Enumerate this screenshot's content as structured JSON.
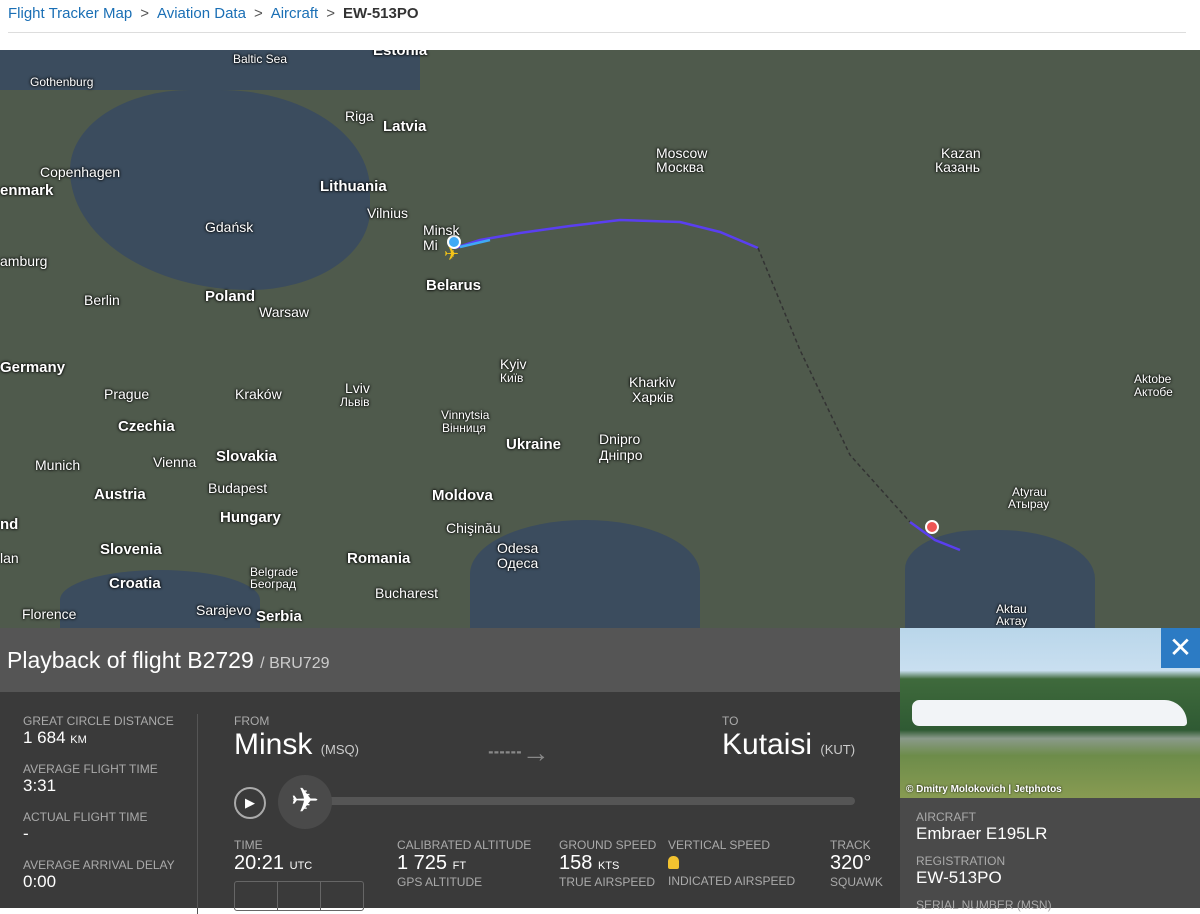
{
  "breadcrumb": [
    "Flight Tracker Map",
    "Aviation Data",
    "Aircraft",
    "EW-513PO"
  ],
  "map": {
    "labels": [
      [
        "Gothenburg",
        "sm",
        30,
        75
      ],
      [
        "Baltic Sea",
        "sm",
        233,
        52
      ],
      [
        "Riga",
        "",
        345,
        108
      ],
      [
        "Latvia",
        "big",
        383,
        118
      ],
      [
        "Estonia",
        "big",
        373,
        42
      ],
      [
        "Copenhagen",
        "",
        40,
        164
      ],
      [
        "enmark",
        "big",
        0,
        182
      ],
      [
        "Lithuania",
        "big",
        320,
        178
      ],
      [
        "Vilnius",
        "",
        367,
        205
      ],
      [
        "Gdańsk",
        "",
        205,
        219
      ],
      [
        "Minsk",
        "",
        423,
        222
      ],
      [
        "Mi",
        "",
        423,
        237
      ],
      [
        "Belarus",
        "big",
        426,
        277
      ],
      [
        "amburg",
        "",
        0,
        253
      ],
      [
        "Berlin",
        "",
        84,
        292
      ],
      [
        "Poland",
        "big",
        205,
        288
      ],
      [
        "Warsaw",
        "",
        259,
        304
      ],
      [
        "Germany",
        "big",
        0,
        359
      ],
      [
        "Prague",
        "",
        104,
        386
      ],
      [
        "Kraków",
        "",
        235,
        386
      ],
      [
        "Lviv",
        "",
        345,
        380
      ],
      [
        "Львів",
        "sm",
        340,
        395
      ],
      [
        "Kyiv",
        "",
        500,
        356
      ],
      [
        "Київ",
        "sm",
        500,
        371
      ],
      [
        "Czechia",
        "big",
        118,
        418
      ],
      [
        "Vinnytsia",
        "sm",
        441,
        408
      ],
      [
        "Вінниця",
        "sm",
        442,
        421
      ],
      [
        "Ukraine",
        "big",
        506,
        436
      ],
      [
        "Kharkiv",
        "",
        629,
        374
      ],
      [
        "Харків",
        "",
        632,
        389
      ],
      [
        "Dnipro",
        "",
        599,
        431
      ],
      [
        "Дніпро",
        "",
        599,
        447
      ],
      [
        "Munich",
        "",
        35,
        457
      ],
      [
        "Vienna",
        "",
        153,
        454
      ],
      [
        "Slovakia",
        "big",
        216,
        448
      ],
      [
        "Budapest",
        "",
        208,
        480
      ],
      [
        "Austria",
        "big",
        94,
        486
      ],
      [
        "Hungary",
        "big",
        220,
        509
      ],
      [
        "Moldova",
        "big",
        432,
        487
      ],
      [
        "Chişinău",
        "",
        446,
        520
      ],
      [
        "Odesa",
        "",
        497,
        540
      ],
      [
        "Одеса",
        "",
        497,
        555
      ],
      [
        "Slovenia",
        "big",
        100,
        541
      ],
      [
        "Romania",
        "big",
        347,
        550
      ],
      [
        "nd",
        "big",
        0,
        516
      ],
      [
        "lan",
        "",
        0,
        550
      ],
      [
        "Croatia",
        "big",
        109,
        575
      ],
      [
        "Belgrade",
        "sm",
        250,
        565
      ],
      [
        "Београд",
        "sm",
        250,
        577
      ],
      [
        "Bucharest",
        "",
        375,
        585
      ],
      [
        "Florence",
        "",
        22,
        606
      ],
      [
        "Sarajevo",
        "",
        196,
        602
      ],
      [
        "Serbia",
        "big",
        256,
        608
      ],
      [
        "Moscow",
        "",
        656,
        145
      ],
      [
        "Москва",
        "",
        656,
        159
      ],
      [
        "Kazan",
        "",
        941,
        145
      ],
      [
        "Казань",
        "",
        935,
        159
      ],
      [
        "Aktobe",
        "sm",
        1134,
        372
      ],
      [
        "Актобе",
        "sm",
        1134,
        385
      ],
      [
        "Atyrau",
        "sm",
        1012,
        485
      ],
      [
        "Атырау",
        "sm",
        1008,
        497
      ],
      [
        "Aktau",
        "sm",
        996,
        602
      ],
      [
        "Актау",
        "sm",
        996,
        614
      ]
    ]
  },
  "playback": {
    "title": "Playback of flight B2729",
    "callsign": "/ BRU729"
  },
  "stats": [
    {
      "label": "Great circle distance",
      "value": "1 684",
      "unit": "KM"
    },
    {
      "label": "Average flight time",
      "value": "3:31"
    },
    {
      "label": "Actual flight time",
      "value": "-"
    },
    {
      "label": "Average arrival delay",
      "value": "0:00"
    }
  ],
  "route": {
    "from_label": "FROM",
    "from": "Minsk",
    "from_code": "(MSQ)",
    "to_label": "TO",
    "to": "Kutaisi",
    "to_code": "(KUT)",
    "progress": 0.0
  },
  "telemetry": {
    "time_label": "TIME",
    "time": "20:21",
    "time_unit": "UTC",
    "cal_alt_label": "CALIBRATED ALTITUDE",
    "cal_alt": "1 725",
    "cal_alt_unit": "FT",
    "gps_alt_label": "GPS ALTITUDE",
    "gs_label": "GROUND SPEED",
    "gs": "158",
    "gs_unit": "KTS",
    "tas_label": "TRUE AIRSPEED",
    "vs_label": "VERTICAL SPEED",
    "ias_label": "INDICATED AIRSPEED",
    "track_label": "TRACK",
    "track": "320°",
    "squawk_label": "SQUAWK"
  },
  "photo": {
    "credit": "© Dmitry Molokovich | Jetphotos"
  },
  "aircraft": {
    "type_label": "AIRCRAFT",
    "type": "Embraer E195LR",
    "reg_label": "REGISTRATION",
    "reg": "EW-513PO",
    "msn_label": "SERIAL NUMBER (MSN)"
  },
  "colors": {
    "track": "#5a3ff0",
    "accent": "#2c7bc4",
    "lock": "#f2c230"
  }
}
